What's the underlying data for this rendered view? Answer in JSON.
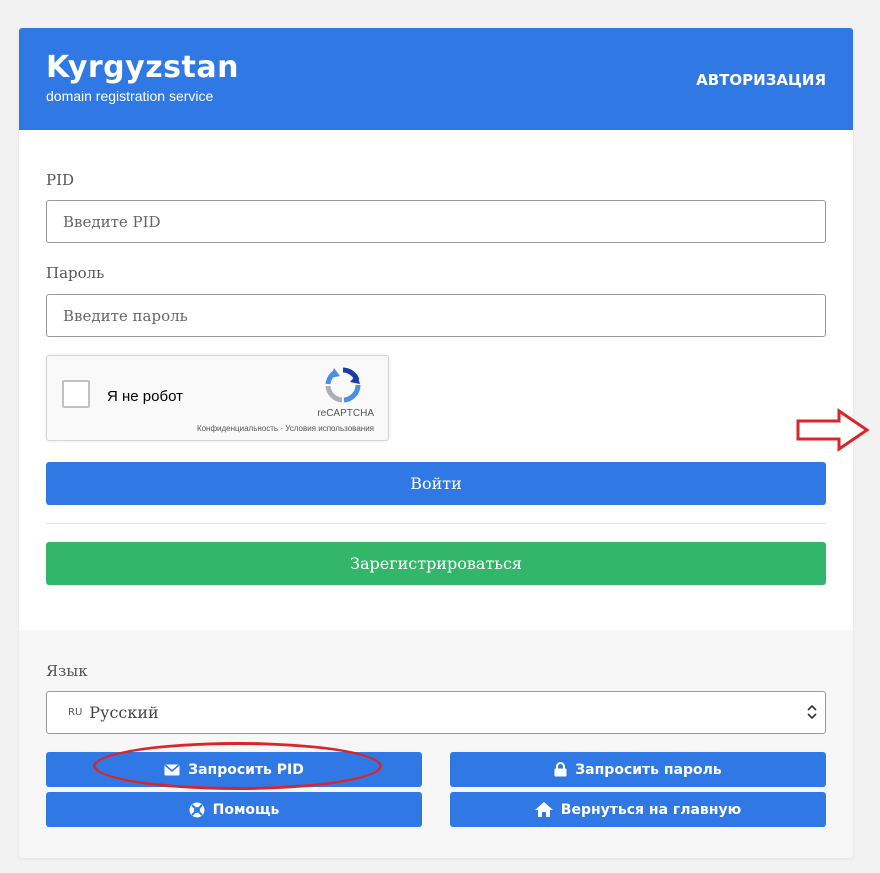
{
  "header": {
    "logo_title": "Kyrgyzstan",
    "logo_subtitle": "domain registration service",
    "action": "АВТОРИЗАЦИЯ"
  },
  "form": {
    "pid_label": "PID",
    "pid_placeholder": "Введите PID",
    "password_label": "Пароль",
    "password_placeholder": "Введите пароль",
    "captcha": {
      "text": "Я не робот",
      "brand": "reCAPTCHA",
      "links": "Конфиденциальность - Условия использования"
    },
    "login_button": "Войти",
    "register_button": "Зарегистрироваться"
  },
  "footer": {
    "language_label": "Язык",
    "language": {
      "flag": "RU",
      "selected": "Русский"
    },
    "buttons": {
      "request_pid": "Запросить PID",
      "request_password": "Запросить пароль",
      "help": "Помощь",
      "home": "Вернуться на главную"
    }
  },
  "colors": {
    "primary": "#3078e3",
    "success": "#32b66a",
    "annotation": "#d8262a"
  },
  "icons": {
    "request_pid": "envelope-icon",
    "request_password": "lock-icon",
    "help": "lifebuoy-icon",
    "home": "home-icon"
  }
}
